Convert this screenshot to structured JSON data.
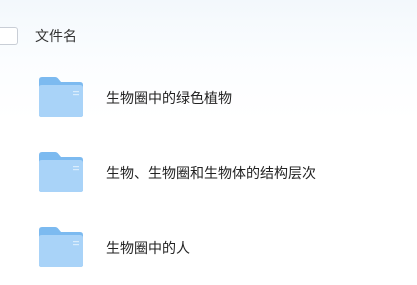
{
  "header": {
    "column_label": "文件名"
  },
  "files": [
    {
      "name": "生物圈中的绿色植物",
      "icon": "folder-icon"
    },
    {
      "name": "生物、生物圈和生物体的结构层次",
      "icon": "folder-icon"
    },
    {
      "name": "生物圈中的人",
      "icon": "folder-icon"
    }
  ],
  "colors": {
    "folder_light": "#a8d2f7",
    "folder_dark": "#6eb2ee",
    "text": "#222222"
  }
}
